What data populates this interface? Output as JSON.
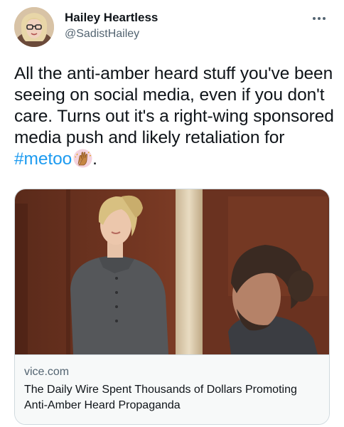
{
  "author": {
    "display_name": "Hailey Heartless",
    "handle": "@SadistHailey"
  },
  "tweet": {
    "text_part1": "All the anti-amber heard stuff you've been seeing on social media, even if you don't care. Turns out it's a right-wing sponsored media push and likely retaliation for ",
    "hashtag": "#metoo",
    "text_end": "."
  },
  "link_card": {
    "domain": "vice.com",
    "title": "The Daily Wire Spent Thousands of Dollars Promoting Anti-Amber Heard Propaganda"
  },
  "icons": {
    "more": "more-horizontal-icon",
    "emoji": "raised-hands-emoji"
  },
  "colors": {
    "link": "#1d9bf0",
    "text": "#0f1419",
    "secondary": "#536471",
    "border": "#cfd9de"
  }
}
